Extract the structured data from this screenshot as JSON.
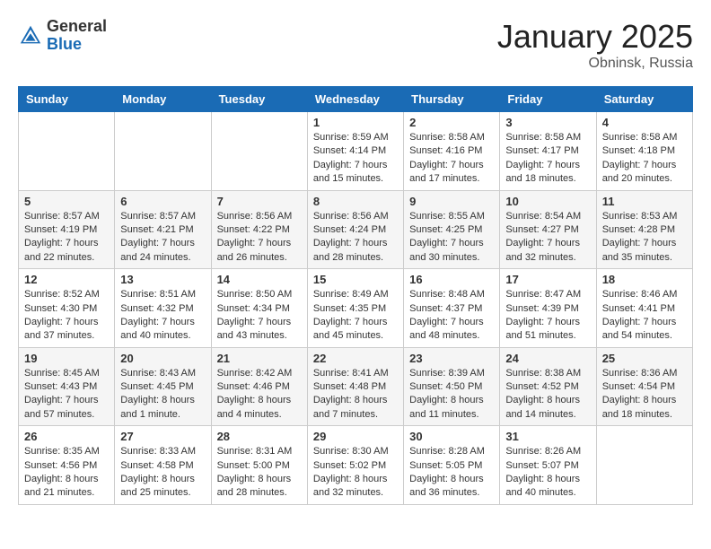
{
  "header": {
    "logo_general": "General",
    "logo_blue": "Blue",
    "month_title": "January 2025",
    "location": "Obninsk, Russia"
  },
  "days_of_week": [
    "Sunday",
    "Monday",
    "Tuesday",
    "Wednesday",
    "Thursday",
    "Friday",
    "Saturday"
  ],
  "weeks": [
    [
      {
        "day": "",
        "info": ""
      },
      {
        "day": "",
        "info": ""
      },
      {
        "day": "",
        "info": ""
      },
      {
        "day": "1",
        "info": "Sunrise: 8:59 AM\nSunset: 4:14 PM\nDaylight: 7 hours\nand 15 minutes."
      },
      {
        "day": "2",
        "info": "Sunrise: 8:58 AM\nSunset: 4:16 PM\nDaylight: 7 hours\nand 17 minutes."
      },
      {
        "day": "3",
        "info": "Sunrise: 8:58 AM\nSunset: 4:17 PM\nDaylight: 7 hours\nand 18 minutes."
      },
      {
        "day": "4",
        "info": "Sunrise: 8:58 AM\nSunset: 4:18 PM\nDaylight: 7 hours\nand 20 minutes."
      }
    ],
    [
      {
        "day": "5",
        "info": "Sunrise: 8:57 AM\nSunset: 4:19 PM\nDaylight: 7 hours\nand 22 minutes."
      },
      {
        "day": "6",
        "info": "Sunrise: 8:57 AM\nSunset: 4:21 PM\nDaylight: 7 hours\nand 24 minutes."
      },
      {
        "day": "7",
        "info": "Sunrise: 8:56 AM\nSunset: 4:22 PM\nDaylight: 7 hours\nand 26 minutes."
      },
      {
        "day": "8",
        "info": "Sunrise: 8:56 AM\nSunset: 4:24 PM\nDaylight: 7 hours\nand 28 minutes."
      },
      {
        "day": "9",
        "info": "Sunrise: 8:55 AM\nSunset: 4:25 PM\nDaylight: 7 hours\nand 30 minutes."
      },
      {
        "day": "10",
        "info": "Sunrise: 8:54 AM\nSunset: 4:27 PM\nDaylight: 7 hours\nand 32 minutes."
      },
      {
        "day": "11",
        "info": "Sunrise: 8:53 AM\nSunset: 4:28 PM\nDaylight: 7 hours\nand 35 minutes."
      }
    ],
    [
      {
        "day": "12",
        "info": "Sunrise: 8:52 AM\nSunset: 4:30 PM\nDaylight: 7 hours\nand 37 minutes."
      },
      {
        "day": "13",
        "info": "Sunrise: 8:51 AM\nSunset: 4:32 PM\nDaylight: 7 hours\nand 40 minutes."
      },
      {
        "day": "14",
        "info": "Sunrise: 8:50 AM\nSunset: 4:34 PM\nDaylight: 7 hours\nand 43 minutes."
      },
      {
        "day": "15",
        "info": "Sunrise: 8:49 AM\nSunset: 4:35 PM\nDaylight: 7 hours\nand 45 minutes."
      },
      {
        "day": "16",
        "info": "Sunrise: 8:48 AM\nSunset: 4:37 PM\nDaylight: 7 hours\nand 48 minutes."
      },
      {
        "day": "17",
        "info": "Sunrise: 8:47 AM\nSunset: 4:39 PM\nDaylight: 7 hours\nand 51 minutes."
      },
      {
        "day": "18",
        "info": "Sunrise: 8:46 AM\nSunset: 4:41 PM\nDaylight: 7 hours\nand 54 minutes."
      }
    ],
    [
      {
        "day": "19",
        "info": "Sunrise: 8:45 AM\nSunset: 4:43 PM\nDaylight: 7 hours\nand 57 minutes."
      },
      {
        "day": "20",
        "info": "Sunrise: 8:43 AM\nSunset: 4:45 PM\nDaylight: 8 hours\nand 1 minute."
      },
      {
        "day": "21",
        "info": "Sunrise: 8:42 AM\nSunset: 4:46 PM\nDaylight: 8 hours\nand 4 minutes."
      },
      {
        "day": "22",
        "info": "Sunrise: 8:41 AM\nSunset: 4:48 PM\nDaylight: 8 hours\nand 7 minutes."
      },
      {
        "day": "23",
        "info": "Sunrise: 8:39 AM\nSunset: 4:50 PM\nDaylight: 8 hours\nand 11 minutes."
      },
      {
        "day": "24",
        "info": "Sunrise: 8:38 AM\nSunset: 4:52 PM\nDaylight: 8 hours\nand 14 minutes."
      },
      {
        "day": "25",
        "info": "Sunrise: 8:36 AM\nSunset: 4:54 PM\nDaylight: 8 hours\nand 18 minutes."
      }
    ],
    [
      {
        "day": "26",
        "info": "Sunrise: 8:35 AM\nSunset: 4:56 PM\nDaylight: 8 hours\nand 21 minutes."
      },
      {
        "day": "27",
        "info": "Sunrise: 8:33 AM\nSunset: 4:58 PM\nDaylight: 8 hours\nand 25 minutes."
      },
      {
        "day": "28",
        "info": "Sunrise: 8:31 AM\nSunset: 5:00 PM\nDaylight: 8 hours\nand 28 minutes."
      },
      {
        "day": "29",
        "info": "Sunrise: 8:30 AM\nSunset: 5:02 PM\nDaylight: 8 hours\nand 32 minutes."
      },
      {
        "day": "30",
        "info": "Sunrise: 8:28 AM\nSunset: 5:05 PM\nDaylight: 8 hours\nand 36 minutes."
      },
      {
        "day": "31",
        "info": "Sunrise: 8:26 AM\nSunset: 5:07 PM\nDaylight: 8 hours\nand 40 minutes."
      },
      {
        "day": "",
        "info": ""
      }
    ]
  ]
}
